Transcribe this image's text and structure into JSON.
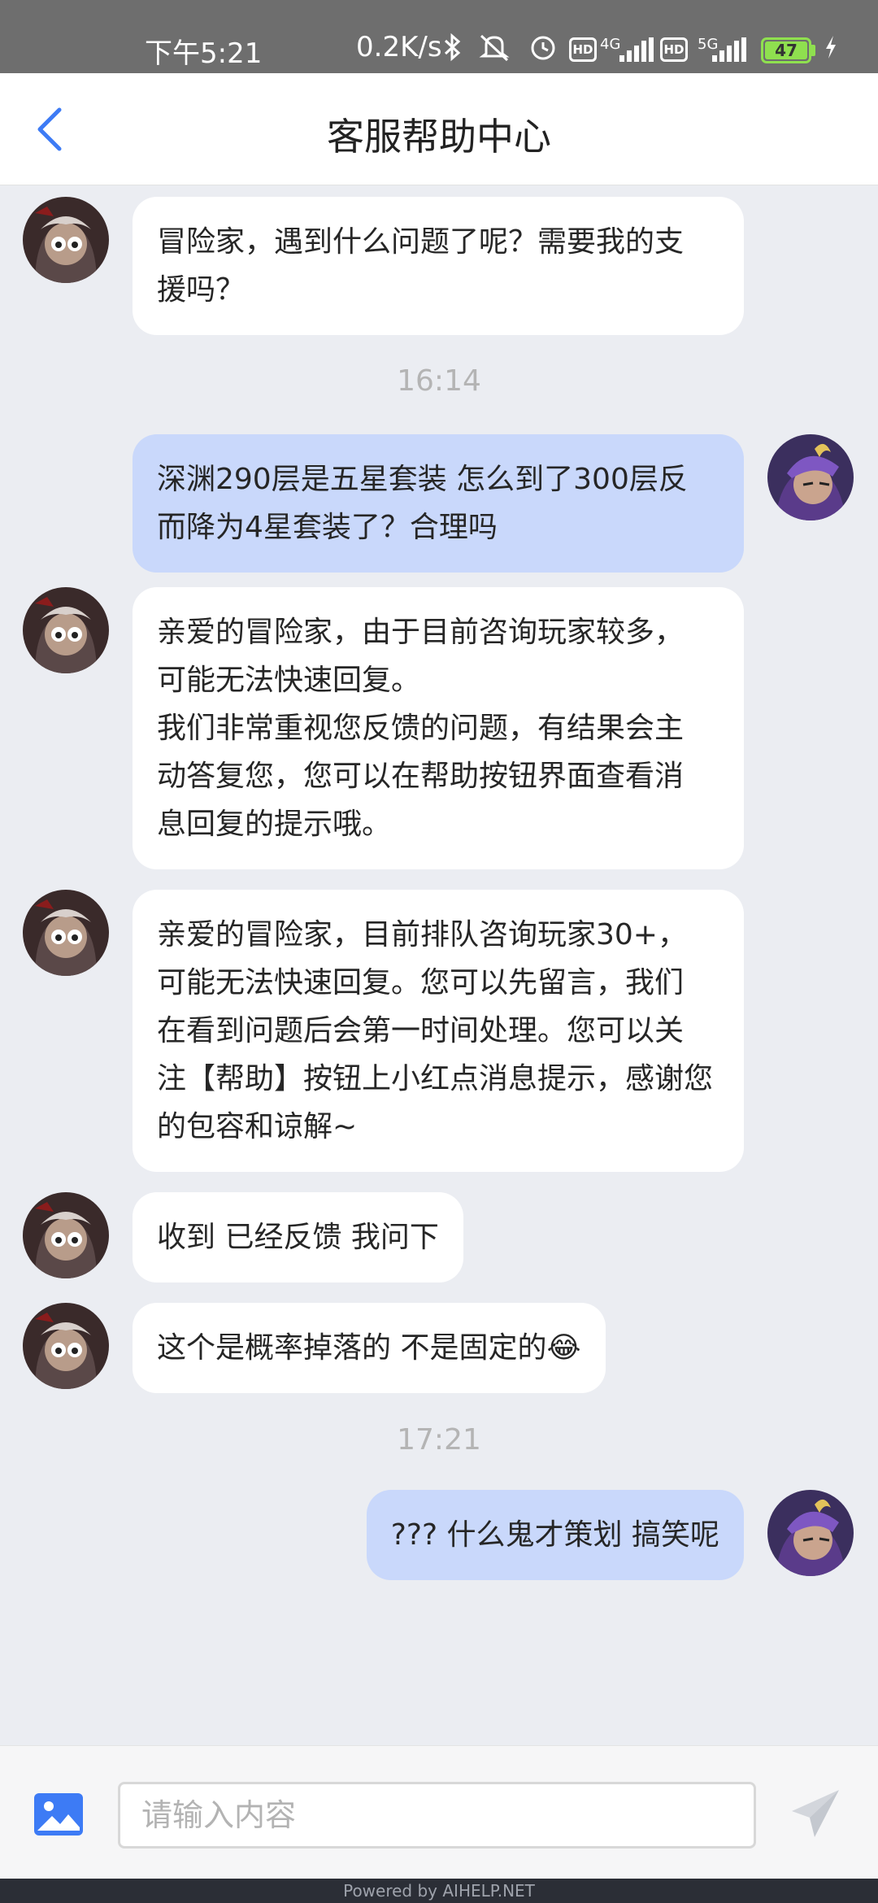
{
  "status_bar": {
    "time": "下午5:21",
    "net_speed": "0.2K/s",
    "hd_label": "HD",
    "net1": "4G",
    "net2": "5G",
    "battery_level": "47"
  },
  "header": {
    "title": "客服帮助中心"
  },
  "messages": [
    {
      "sender": "agent",
      "text": "冒险家，遇到什么问题了呢？需要我的支\n援吗？"
    },
    {
      "type": "timestamp",
      "text": "16:14"
    },
    {
      "sender": "user",
      "text": "深渊290层是五星套装 怎么到了300层反\n而降为4星套装了？合理吗"
    },
    {
      "sender": "agent",
      "text": "亲爱的冒险家，由于目前咨询玩家较多，\n可能无法快速回复。\n我们非常重视您反馈的问题，有结果会主\n动答复您，您可以在帮助按钮界面查看消\n息回复的提示哦。"
    },
    {
      "sender": "agent",
      "text": "亲爱的冒险家，目前排队咨询玩家30+，\n可能无法快速回复。您可以先留言，我们\n在看到问题后会第一时间处理。您可以关\n注【帮助】按钮上小红点消息提示，感谢您\n的包容和谅解~"
    },
    {
      "sender": "agent",
      "text": "收到 已经反馈 我问下"
    },
    {
      "sender": "agent",
      "text": "这个是概率掉落的 不是固定的😂"
    },
    {
      "type": "timestamp",
      "text": "17:21"
    },
    {
      "sender": "user",
      "text": "??? 什么鬼才策划 搞笑呢"
    }
  ],
  "input": {
    "placeholder": "请输入内容"
  },
  "footer": {
    "text": "Powered by AIHELP.NET"
  },
  "colors": {
    "accent": "#3d7bf5",
    "user_bubble": "#c9d8fb",
    "agent_bubble": "#ffffff",
    "background": "#ebedf2"
  },
  "icons": [
    "back-arrow-icon",
    "bluetooth-icon",
    "mute-icon",
    "alarm-icon",
    "signal-icon",
    "battery-icon",
    "charging-icon",
    "image-icon",
    "send-icon"
  ]
}
